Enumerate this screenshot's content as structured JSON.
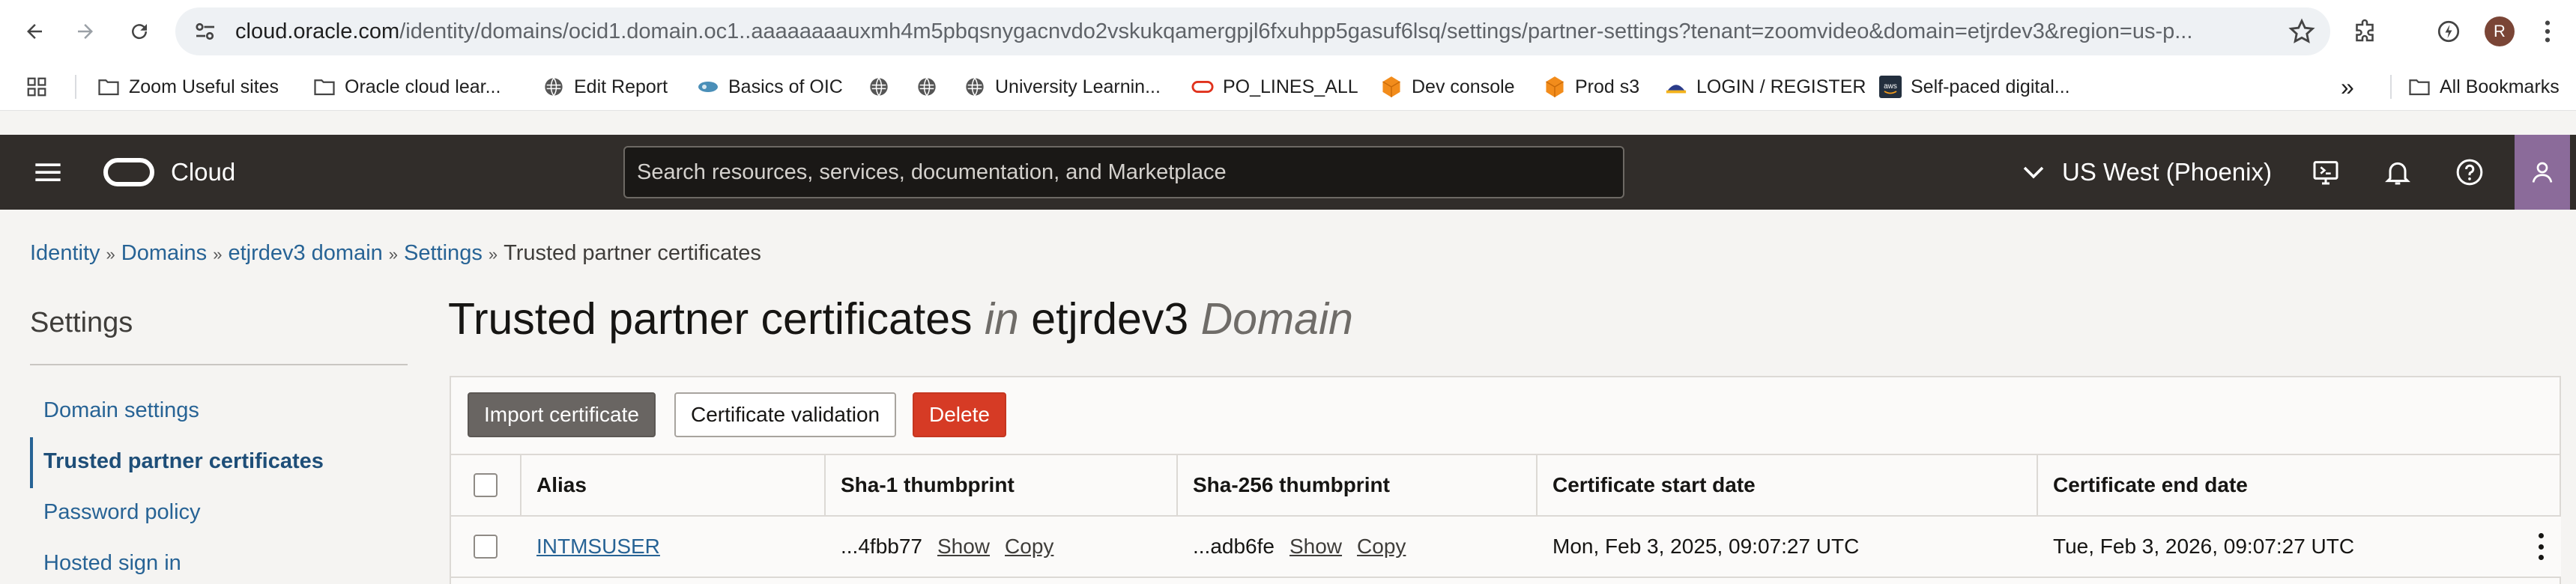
{
  "browser": {
    "url_host": "cloud.oracle.com",
    "url_path": "/identity/domains/ocid1.domain.oc1..aaaaaaaauxmh4m5pbqsnygacnvdo2vskukqamergpjl6fxuhpp5gasuf6lsq/settings/partner-settings?tenant=zoomvideo&domain=etjrdev3&region=us-p...",
    "profile_initial": "R",
    "icons": [
      "back-icon",
      "forward-icon",
      "reload-icon",
      "site-settings-icon",
      "bookmark-star-icon",
      "extensions-icon",
      "performance-icon",
      "menu-kebab-icon"
    ]
  },
  "bookmarks": {
    "items": [
      {
        "label": "Zoom Useful sites",
        "icon": "folder-icon"
      },
      {
        "label": "Oracle cloud lear...",
        "icon": "folder-icon"
      },
      {
        "label": "Edit Report",
        "icon": "globe-icon"
      },
      {
        "label": "Basics of OIC",
        "icon": "oic-icon"
      },
      {
        "label": "",
        "icon": "globe-icon"
      },
      {
        "label": "",
        "icon": "globe-icon"
      },
      {
        "label": "University Learnin...",
        "icon": "globe-icon"
      },
      {
        "label": "PO_LINES_ALL",
        "icon": "oracle-icon"
      },
      {
        "label": "Dev console",
        "icon": "aws-cube-icon"
      },
      {
        "label": "Prod s3",
        "icon": "aws-cube-icon"
      },
      {
        "label": "LOGIN / REGISTER",
        "icon": "hat-icon"
      },
      {
        "label": "Self-paced digital...",
        "icon": "aws-icon"
      }
    ],
    "overflow": "»",
    "all_bookmarks": "All Bookmarks"
  },
  "header": {
    "brand": "Cloud",
    "search_placeholder": "Search resources, services, documentation, and Marketplace",
    "region": "US West (Phoenix)",
    "icons": [
      "cloud-shell-icon",
      "notifications-bell-icon",
      "help-icon",
      "user-profile-icon"
    ]
  },
  "breadcrumb": {
    "items": [
      "Identity",
      "Domains",
      "etjrdev3 domain",
      "Settings"
    ],
    "current": "Trusted partner certificates",
    "separator": "»"
  },
  "sidebar": {
    "title": "Settings",
    "items": [
      {
        "label": "Domain settings",
        "active": false
      },
      {
        "label": "Trusted partner certificates",
        "active": true
      },
      {
        "label": "Password policy",
        "active": false
      },
      {
        "label": "Hosted sign in",
        "active": false
      }
    ]
  },
  "page": {
    "title_main": "Trusted partner certificates",
    "title_in": "in",
    "title_domain": "etjrdev3",
    "title_domain_word": "Domain"
  },
  "toolbar": {
    "import_label": "Import certificate",
    "validation_label": "Certificate validation",
    "delete_label": "Delete"
  },
  "table": {
    "columns": [
      "Alias",
      "Sha-1 thumbprint",
      "Sha-256 thumbprint",
      "Certificate start date",
      "Certificate end date"
    ],
    "rows": [
      {
        "alias": "INTMSUSER",
        "sha1": "...4fbb77",
        "sha256": "...adb6fe",
        "show_label": "Show",
        "copy_label": "Copy",
        "start_date": "Mon, Feb 3, 2025, 09:07:27 UTC",
        "end_date": "Tue, Feb 3, 2026, 09:07:27 UTC"
      }
    ]
  },
  "colors": {
    "header_bg": "#312d2a",
    "link": "#276395",
    "delete": "#d63b25",
    "import": "#696562",
    "profile": "#8b6b9a"
  }
}
